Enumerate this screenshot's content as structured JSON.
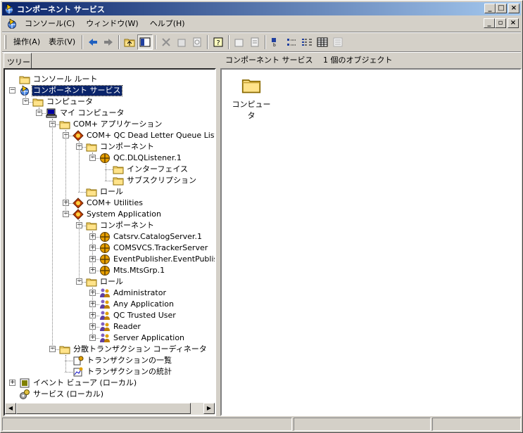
{
  "window": {
    "title": "コンポーネント サービス",
    "min_label": "_",
    "max_label": "□",
    "close_label": "×"
  },
  "menu": {
    "items": [
      "コンソール(C)",
      "ウィンドウ(W)",
      "ヘルプ(H)"
    ],
    "mdi_min": "_",
    "mdi_restore": "▫",
    "mdi_close": "×"
  },
  "toolbar": {
    "action_label": "操作(A)",
    "view_label": "表示(V)"
  },
  "pane": {
    "tab_label": "ツリー",
    "right_header": "コンポーネント サービス　 1 個のオブジェクト"
  },
  "tree": [
    "コンソール ルート",
    "コンポーネント サービス",
    "コンピュータ",
    "マイ コンピュータ",
    "COM+ アプリケーション",
    "COM+ QC Dead Letter Queue Lister",
    "コンポーネント",
    "QC.DLQListener.1",
    "インターフェイス",
    "サブスクリプション",
    "ロール",
    "COM+ Utilities",
    "System Application",
    "コンポーネント",
    "Catsrv.CatalogServer.1",
    "COMSVCS.TrackerServer",
    "EventPublisher.EventPublisher",
    "Mts.MtsGrp.1",
    "ロール",
    "Administrator",
    "Any Application",
    "QC Trusted User",
    "Reader",
    "Server Application",
    "分散トランザクション コーディネータ",
    "トランザクションの一覧",
    "トランザクションの統計",
    "イベント ビューア (ローカル)",
    "サービス (ローカル)"
  ],
  "right_items": [
    {
      "label": "コンピュータ",
      "icon": "folder-icon"
    }
  ],
  "colors": {
    "selection": "#0a246a",
    "title_start": "#0a246a",
    "title_end": "#a6caf0",
    "folder": "#ffd966",
    "face": "#d4d0c8"
  }
}
